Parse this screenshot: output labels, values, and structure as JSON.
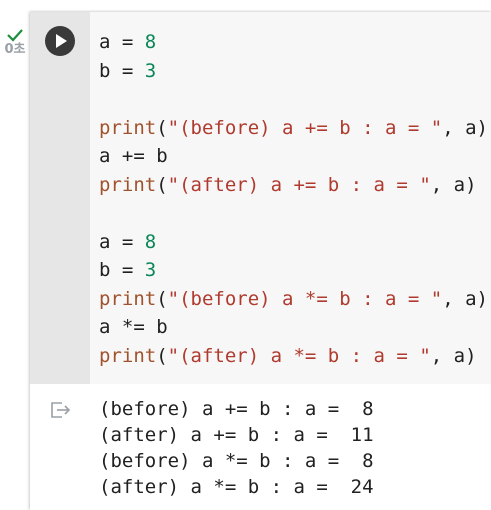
{
  "execution": {
    "status_icon": "check-icon",
    "time": "0초"
  },
  "cell": {
    "run_icon": "play-icon",
    "code": [
      [
        {
          "t": "a = ",
          "c": ""
        },
        {
          "t": "8",
          "c": "num"
        }
      ],
      [
        {
          "t": "b = ",
          "c": ""
        },
        {
          "t": "3",
          "c": "num"
        }
      ],
      [],
      [
        {
          "t": "print",
          "c": "kw"
        },
        {
          "t": "(",
          "c": ""
        },
        {
          "t": "\"(before) a += b : a = \"",
          "c": "str"
        },
        {
          "t": ", a)",
          "c": ""
        }
      ],
      [
        {
          "t": "a += b",
          "c": ""
        }
      ],
      [
        {
          "t": "print",
          "c": "kw"
        },
        {
          "t": "(",
          "c": ""
        },
        {
          "t": "\"(after) a += b : a = \"",
          "c": "str"
        },
        {
          "t": ", a)",
          "c": ""
        }
      ],
      [],
      [
        {
          "t": "a = ",
          "c": ""
        },
        {
          "t": "8",
          "c": "num"
        }
      ],
      [
        {
          "t": "b = ",
          "c": ""
        },
        {
          "t": "3",
          "c": "num"
        }
      ],
      [
        {
          "t": "print",
          "c": "kw"
        },
        {
          "t": "(",
          "c": ""
        },
        {
          "t": "\"(before) a *= b : a = \"",
          "c": "str"
        },
        {
          "t": ", a)",
          "c": ""
        }
      ],
      [
        {
          "t": "a *= b",
          "c": ""
        }
      ],
      [
        {
          "t": "print",
          "c": "kw"
        },
        {
          "t": "(",
          "c": ""
        },
        {
          "t": "\"(after) a *= b : a = \"",
          "c": "str"
        },
        {
          "t": ", a)",
          "c": ""
        }
      ]
    ],
    "output_icon": "output-exit-icon",
    "output": [
      "(before) a += b : a =  8",
      "(after) a += b : a =  11",
      "(before) a *= b : a =  8",
      "(after) a *= b : a =  24"
    ]
  }
}
